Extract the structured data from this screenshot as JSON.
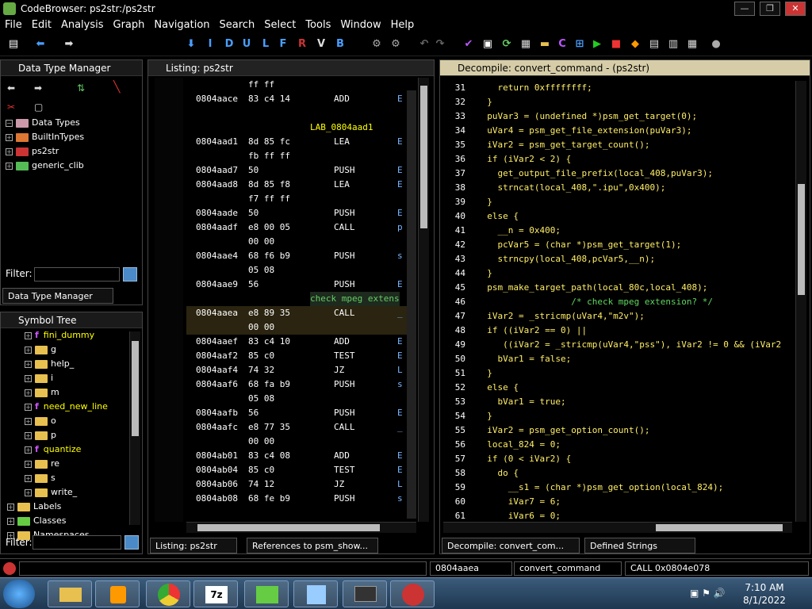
{
  "window": {
    "title": "CodeBrowser: ps2str:/ps2str"
  },
  "menu": [
    "File",
    "Edit",
    "Analysis",
    "Graph",
    "Navigation",
    "Search",
    "Select",
    "Tools",
    "Window",
    "Help"
  ],
  "toolbar": {
    "letters": [
      "I",
      "D",
      "U",
      "L",
      "F",
      "R",
      "V",
      "B"
    ]
  },
  "dtm": {
    "title": "Data Type Manager",
    "root": "Data Types",
    "items": [
      "BuiltInTypes",
      "ps2str",
      "generic_clib"
    ],
    "filter_label": "Filter:",
    "tab_label": "Data Type Manager"
  },
  "symtree": {
    "title": "Symbol Tree",
    "items": [
      {
        "label": "fini_dummy",
        "kind": "fn"
      },
      {
        "label": "g",
        "kind": "folder"
      },
      {
        "label": "help_",
        "kind": "folder"
      },
      {
        "label": "i",
        "kind": "folder"
      },
      {
        "label": "m",
        "kind": "folder"
      },
      {
        "label": "need_new_line",
        "kind": "fn"
      },
      {
        "label": "o",
        "kind": "folder"
      },
      {
        "label": "p",
        "kind": "folder"
      },
      {
        "label": "quantize",
        "kind": "fn"
      },
      {
        "label": "re",
        "kind": "folder"
      },
      {
        "label": "s",
        "kind": "folder"
      },
      {
        "label": "write_",
        "kind": "folder"
      },
      {
        "label": "Labels",
        "kind": "top"
      },
      {
        "label": "Classes",
        "kind": "top"
      },
      {
        "label": "Namespaces",
        "kind": "top"
      }
    ],
    "filter_label": "Filter:"
  },
  "listing": {
    "title": "Listing:  ps2str",
    "rows": [
      {
        "addr": "",
        "bytes": "ff ff",
        "mn": "",
        "op": ""
      },
      {
        "addr": "0804aace",
        "bytes": "83 c4 14",
        "mn": "ADD",
        "op": "E"
      },
      {
        "addr": "",
        "bytes": "",
        "mn": "",
        "op": ""
      },
      {
        "addr": "",
        "bytes": "",
        "mn": "LAB_0804aad1",
        "op": "",
        "label": true
      },
      {
        "addr": "0804aad1",
        "bytes": "8d 85 fc",
        "mn": "LEA",
        "op": "E"
      },
      {
        "addr": "",
        "bytes": "fb ff ff",
        "mn": "",
        "op": ""
      },
      {
        "addr": "0804aad7",
        "bytes": "50",
        "mn": "PUSH",
        "op": "E"
      },
      {
        "addr": "0804aad8",
        "bytes": "8d 85 f8",
        "mn": "LEA",
        "op": "E"
      },
      {
        "addr": "",
        "bytes": "f7 ff ff",
        "mn": "",
        "op": ""
      },
      {
        "addr": "0804aade",
        "bytes": "50",
        "mn": "PUSH",
        "op": "E"
      },
      {
        "addr": "0804aadf",
        "bytes": "e8 00 05",
        "mn": "CALL",
        "op": "p"
      },
      {
        "addr": "",
        "bytes": "00 00",
        "mn": "",
        "op": ""
      },
      {
        "addr": "0804aae4",
        "bytes": "68 f6 b9",
        "mn": "PUSH",
        "op": "s"
      },
      {
        "addr": "",
        "bytes": "05 08",
        "mn": "",
        "op": ""
      },
      {
        "addr": "0804aae9",
        "bytes": "56",
        "mn": "PUSH",
        "op": "E"
      },
      {
        "addr": "",
        "bytes": "",
        "mn": "check mpeg extens",
        "op": "",
        "comment": true
      },
      {
        "addr": "0804aaea",
        "bytes": "e8 89 35",
        "mn": "CALL",
        "op": "_",
        "hl": true
      },
      {
        "addr": "",
        "bytes": "00 00",
        "mn": "",
        "op": "",
        "hl": true
      },
      {
        "addr": "0804aaef",
        "bytes": "83 c4 10",
        "mn": "ADD",
        "op": "E"
      },
      {
        "addr": "0804aaf2",
        "bytes": "85 c0",
        "mn": "TEST",
        "op": "E"
      },
      {
        "addr": "0804aaf4",
        "bytes": "74 32",
        "mn": "JZ",
        "op": "L"
      },
      {
        "addr": "0804aaf6",
        "bytes": "68 fa b9",
        "mn": "PUSH",
        "op": "s"
      },
      {
        "addr": "",
        "bytes": "05 08",
        "mn": "",
        "op": ""
      },
      {
        "addr": "0804aafb",
        "bytes": "56",
        "mn": "PUSH",
        "op": "E"
      },
      {
        "addr": "0804aafc",
        "bytes": "e8 77 35",
        "mn": "CALL",
        "op": "_"
      },
      {
        "addr": "",
        "bytes": "00 00",
        "mn": "",
        "op": ""
      },
      {
        "addr": "0804ab01",
        "bytes": "83 c4 08",
        "mn": "ADD",
        "op": "E"
      },
      {
        "addr": "0804ab04",
        "bytes": "85 c0",
        "mn": "TEST",
        "op": "E"
      },
      {
        "addr": "0804ab06",
        "bytes": "74 12",
        "mn": "JZ",
        "op": "L"
      },
      {
        "addr": "0804ab08",
        "bytes": "68 fe b9",
        "mn": "PUSH",
        "op": "s"
      }
    ]
  },
  "decompile": {
    "title": "Decompile: convert_command -  (ps2str)",
    "lines": [
      {
        "n": "31",
        "code": "    return 0xffffffff;"
      },
      {
        "n": "32",
        "code": "  }"
      },
      {
        "n": "33",
        "code": "  puVar3 = (undefined *)psm_get_target(0);"
      },
      {
        "n": "34",
        "code": "  uVar4 = psm_get_file_extension(puVar3);"
      },
      {
        "n": "35",
        "code": "  iVar2 = psm_get_target_count();"
      },
      {
        "n": "36",
        "code": "  if (iVar2 < 2) {"
      },
      {
        "n": "37",
        "code": "    get_output_file_prefix(local_408,puVar3);"
      },
      {
        "n": "38",
        "code": "    strncat(local_408,\".ipu\",0x400);"
      },
      {
        "n": "39",
        "code": "  }"
      },
      {
        "n": "40",
        "code": "  else {"
      },
      {
        "n": "41",
        "code": "    __n = 0x400;"
      },
      {
        "n": "42",
        "code": "    pcVar5 = (char *)psm_get_target(1);"
      },
      {
        "n": "43",
        "code": "    strncpy(local_408,pcVar5,__n);"
      },
      {
        "n": "44",
        "code": "  }"
      },
      {
        "n": "45",
        "code": "  psm_make_target_path(local_80c,local_408);"
      },
      {
        "n": "46",
        "code": "                  /* check mpeg extension? */"
      },
      {
        "n": "47",
        "code": "  iVar2 = _stricmp(uVar4,\"m2v\");"
      },
      {
        "n": "48",
        "code": "  if ((iVar2 == 0) ||"
      },
      {
        "n": "49",
        "code": "     ((iVar2 = _stricmp(uVar4,\"pss\"), iVar2 != 0 && (iVar2"
      },
      {
        "n": "50",
        "code": "    bVar1 = false;"
      },
      {
        "n": "51",
        "code": "  }"
      },
      {
        "n": "52",
        "code": "  else {"
      },
      {
        "n": "53",
        "code": "    bVar1 = true;"
      },
      {
        "n": "54",
        "code": "  }"
      },
      {
        "n": "55",
        "code": "  iVar2 = psm_get_option_count();"
      },
      {
        "n": "56",
        "code": "  local_824 = 0;"
      },
      {
        "n": "57",
        "code": "  if (0 < iVar2) {"
      },
      {
        "n": "58",
        "code": "    do {"
      },
      {
        "n": "59",
        "code": "      __s1 = (char *)psm_get_option(local_824);"
      },
      {
        "n": "60",
        "code": "      iVar7 = 6;"
      },
      {
        "n": "61",
        "code": "      iVar6 = 0;"
      }
    ]
  },
  "tabs": {
    "listing": "Listing:  ps2str",
    "references": "References to psm_show...",
    "decompile": "Decompile: convert_com...",
    "defined_strings": "Defined Strings"
  },
  "status": {
    "address": "0804aaea",
    "function": "convert_command",
    "instruction": "CALL 0x0804e078"
  },
  "clock": {
    "time": "7:10 AM",
    "date": "8/1/2022"
  }
}
